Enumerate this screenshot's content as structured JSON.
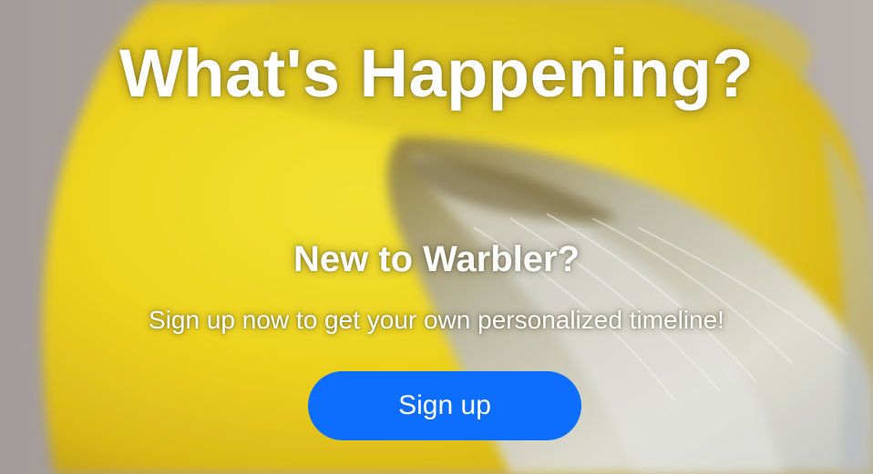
{
  "hero": {
    "title": "What's Happening?",
    "subtitle": "New to Warbler?",
    "tagline": "Sign up now to get your own personalized timeline!",
    "background": "yellow-warbler-photo"
  },
  "signup": {
    "label": "Sign up",
    "color": "#0d6efd"
  }
}
